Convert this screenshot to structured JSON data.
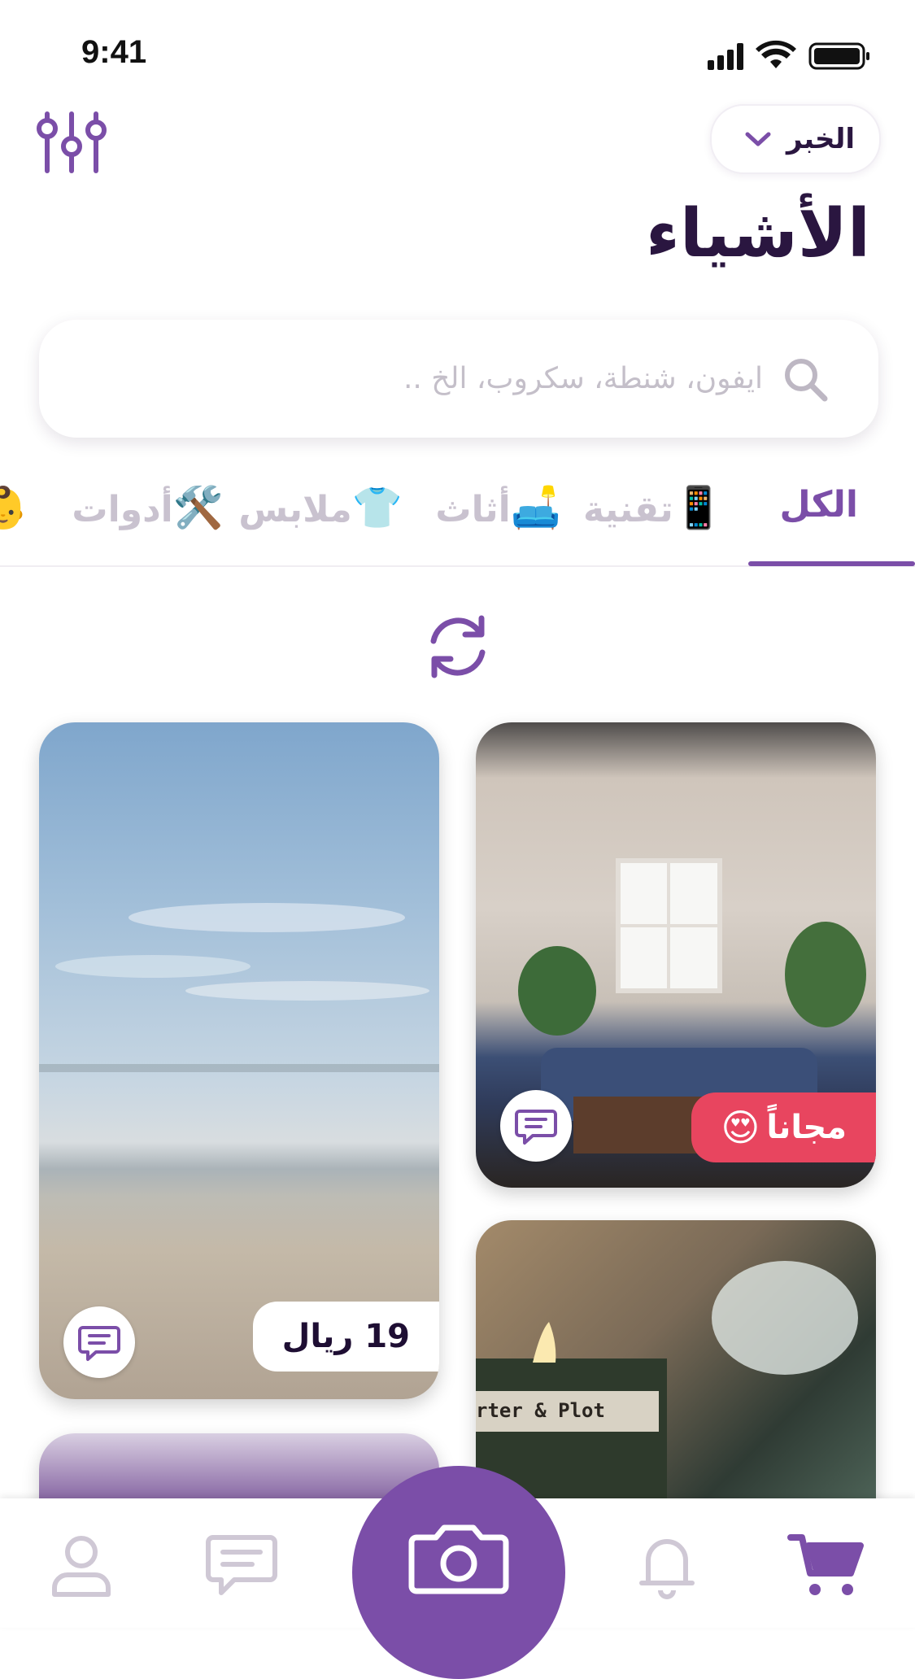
{
  "status_bar": {
    "time": "9:41"
  },
  "header": {
    "city": "الخبر",
    "title": "الأشياء"
  },
  "search": {
    "placeholder": "ايفون، شنطة، سكروب، الخ .."
  },
  "categories": [
    {
      "label": "الكل",
      "emoji": "",
      "active": true
    },
    {
      "label": "تقنية",
      "emoji": "📱"
    },
    {
      "label": "أثاث",
      "emoji": "🛋️"
    },
    {
      "label": "ملابس",
      "emoji": "👕"
    },
    {
      "label": "أدوات",
      "emoji": "🛠️"
    },
    {
      "label": "",
      "emoji": "👶"
    }
  ],
  "listings": [
    {
      "name": "beach",
      "price": "19 ريال"
    },
    {
      "name": "bedroom",
      "price": "مجاناً",
      "price_emoji": "😍",
      "free": true
    },
    {
      "name": "candle",
      "image_text": "rter & Plot"
    },
    {
      "name": "purple-room"
    }
  ],
  "colors": {
    "accent": "#7b4ea8",
    "title": "#2a1640",
    "free_tag": "#e8455f",
    "inactive": "#c9c2cf"
  },
  "icons": {
    "filter": "sliders-icon",
    "search": "search-icon",
    "refresh": "refresh-icon",
    "chat": "chat-bubble-icon",
    "profile": "user-icon",
    "messages": "messages-icon",
    "camera": "camera-icon",
    "notifications": "bell-icon",
    "cart": "cart-icon"
  }
}
